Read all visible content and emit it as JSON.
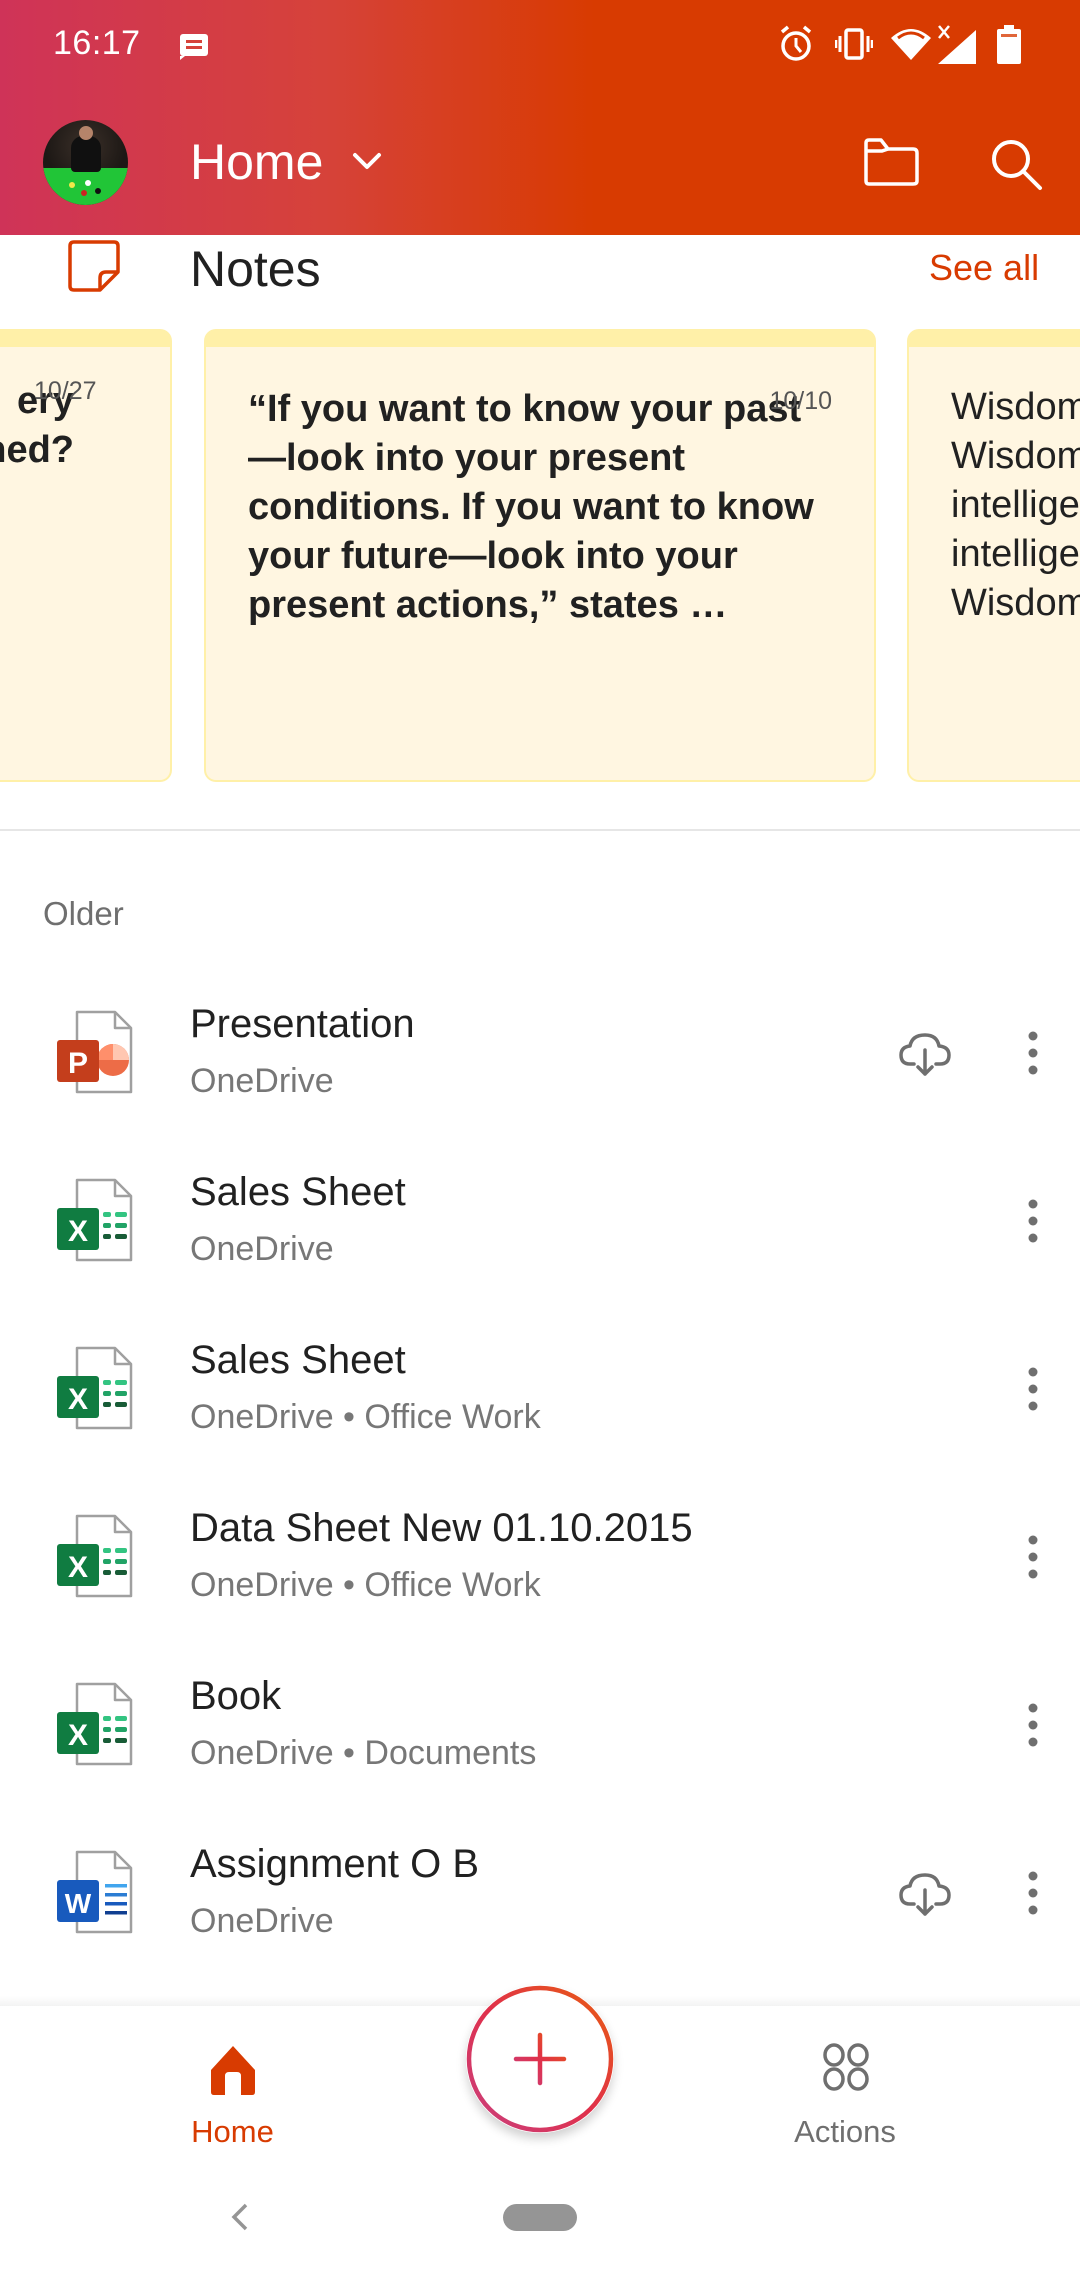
{
  "status_bar": {
    "time": "16:17",
    "left_icons": [
      "message-icon"
    ],
    "right_icons": [
      "alarm-icon",
      "vibrate-icon",
      "wifi-icon",
      "signal-no-data-icon",
      "battery-icon"
    ]
  },
  "app_bar": {
    "title": "Home",
    "avatar": "profile-avatar",
    "actions": [
      "folder-icon",
      "search-icon"
    ]
  },
  "notes": {
    "title": "Notes",
    "see_all": "See all",
    "cards": [
      {
        "text_lines": [
          "ery",
          "shed?"
        ],
        "date": "10/27"
      },
      {
        "text": "“If you want to know your past—look into your present conditions. If you want to know your future—look into your present actions,” states …",
        "date": "10/10"
      },
      {
        "text_lines": [
          "Wisdom",
          "Wisdom",
          "intellige",
          "intellige",
          "Wisdom"
        ],
        "date": ""
      }
    ]
  },
  "section_label": "Older",
  "files": [
    {
      "name": "Presentation",
      "location": "OneDrive",
      "type": "powerpoint",
      "cloud_download": true
    },
    {
      "name": "Sales Sheet",
      "location": "OneDrive",
      "type": "excel",
      "cloud_download": false
    },
    {
      "name": "Sales Sheet",
      "location": "OneDrive • Office Work",
      "type": "excel",
      "cloud_download": false
    },
    {
      "name": "Data Sheet New 01.10.2015",
      "location": "OneDrive • Office Work",
      "type": "excel",
      "cloud_download": false
    },
    {
      "name": "Book",
      "location": "OneDrive • Documents",
      "type": "excel",
      "cloud_download": false
    },
    {
      "name": "Assignment O B",
      "location": "OneDrive",
      "type": "word",
      "cloud_download": true
    }
  ],
  "bottom_nav": {
    "home_label": "Home",
    "actions_label": "Actions",
    "create_button": "plus-icon"
  },
  "colors": {
    "accent": "#d83b01",
    "header_gradient_start": "#cf3358",
    "note_background": "#fff6e1",
    "note_border": "#fff0a8",
    "excel_green": "#107c41",
    "word_blue": "#185abd",
    "powerpoint_red": "#c43e1c"
  }
}
